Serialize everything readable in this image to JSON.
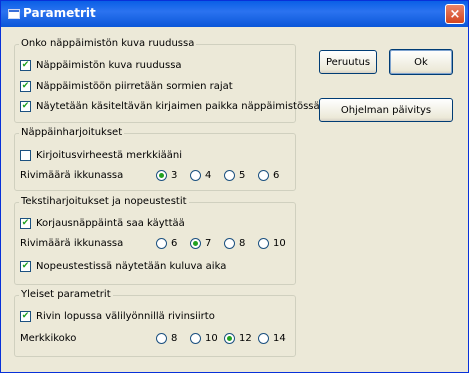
{
  "window": {
    "title": "Parametrit",
    "close_label": "×"
  },
  "groups": {
    "keyboard": {
      "legend": "Onko näppäimistön kuva ruudussa",
      "options": [
        {
          "label": "Näppäimistön kuva ruudussa",
          "checked": true
        },
        {
          "label": "Näppäimistöön piirretään sormien rajat",
          "checked": true
        },
        {
          "label": "Näytetään käsiteltävän kirjaimen paikka näppäimistössä",
          "checked": true
        }
      ]
    },
    "key_exercises": {
      "legend": "Näppäinharjoitukset",
      "typo_sound": {
        "label": "Kirjoitusvirheestä merkkiääni",
        "checked": false
      },
      "rows_label": "Rivimäärä ikkunassa",
      "rows_options": [
        "3",
        "4",
        "5",
        "6"
      ],
      "rows_selected": "3"
    },
    "text_exercises": {
      "legend": "Tekstiharjoitukset ja nopeustestit",
      "backspace": {
        "label": "Korjausnäppäintä saa käyttää",
        "checked": true
      },
      "rows_label": "Rivimäärä ikkunassa",
      "rows_options": [
        "6",
        "7",
        "8",
        "10"
      ],
      "rows_selected": "7",
      "show_time": {
        "label": "Nopeustestissä näytetään kuluva aika",
        "checked": true
      }
    },
    "general": {
      "legend": "Yleiset parametrit",
      "space_wrap": {
        "label": "Rivin lopussa välilyönnillä rivinsiirto",
        "checked": true
      },
      "font_size_label": "Merkkikoko",
      "font_size_options": [
        "8",
        "10",
        "12",
        "14"
      ],
      "font_size_selected": "12"
    }
  },
  "buttons": {
    "cancel": "Peruutus",
    "ok": "Ok",
    "update": "Ohjelman päivitys"
  },
  "colors": {
    "title_bar": "#0a5fe6",
    "window_bg": "#ece9d8",
    "check_green": "#21a121"
  }
}
